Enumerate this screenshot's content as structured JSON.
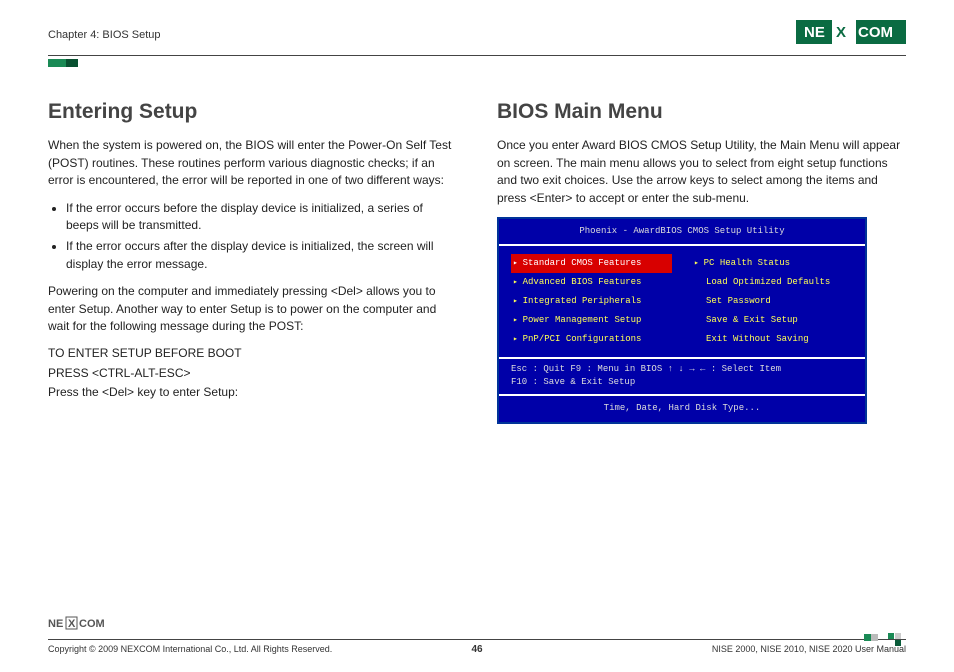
{
  "header": {
    "chapter": "Chapter 4: BIOS Setup",
    "logo_text": "NEXCOM"
  },
  "left": {
    "heading": "Entering Setup",
    "p1": "When the system is powered on, the BIOS will enter the Power-On Self Test (POST) routines. These routines perform various diagnostic checks; if an error is encountered, the error will be reported in one of two different ways:",
    "bullets": [
      "If the error occurs before the display device is initialized, a series of beeps will be transmitted.",
      "If the error occurs after the display device is initialized, the screen will display the error message."
    ],
    "p2": "Powering on the computer and immediately pressing <Del> allows you to enter Setup. Another way to enter Setup is to power on the computer and wait for the following message during the POST:",
    "line1": "TO ENTER SETUP BEFORE BOOT",
    "line2": "PRESS <CTRL-ALT-ESC>",
    "line3": "Press the <Del> key to enter Setup:"
  },
  "right": {
    "heading": "BIOS Main Menu",
    "p1": "Once you enter Award BIOS CMOS Setup Utility, the Main Menu will appear on screen. The main menu allows you to select from eight setup functions and two exit choices. Use the arrow keys to select among the items and press <Enter> to accept or enter the sub-menu."
  },
  "bios": {
    "title": "Phoenix - AwardBIOS CMOS Setup Utility",
    "left_items": [
      {
        "label": "Standard CMOS Features",
        "selected": true,
        "bullet": true
      },
      {
        "label": "Advanced BIOS Features",
        "selected": false,
        "bullet": true
      },
      {
        "label": "Integrated Peripherals",
        "selected": false,
        "bullet": true
      },
      {
        "label": "Power Management Setup",
        "selected": false,
        "bullet": true
      },
      {
        "label": "PnP/PCI Configurations",
        "selected": false,
        "bullet": true
      }
    ],
    "right_items": [
      {
        "label": "PC Health Status",
        "selected": false,
        "bullet": true
      },
      {
        "label": "Load Optimized Defaults",
        "selected": false,
        "bullet": false
      },
      {
        "label": "Set Password",
        "selected": false,
        "bullet": false
      },
      {
        "label": "Save & Exit Setup",
        "selected": false,
        "bullet": false
      },
      {
        "label": "Exit Without Saving",
        "selected": false,
        "bullet": false
      }
    ],
    "help1": "Esc : Quit      F9 : Menu in BIOS        ↑ ↓ → ←   : Select Item",
    "help2": "F10 : Save & Exit Setup",
    "hint": "Time, Date, Hard Disk Type..."
  },
  "footer": {
    "copyright": "Copyright © 2009 NEXCOM International Co., Ltd. All Rights Reserved.",
    "page": "46",
    "manual": "NISE 2000, NISE 2010, NISE 2020 User Manual"
  }
}
